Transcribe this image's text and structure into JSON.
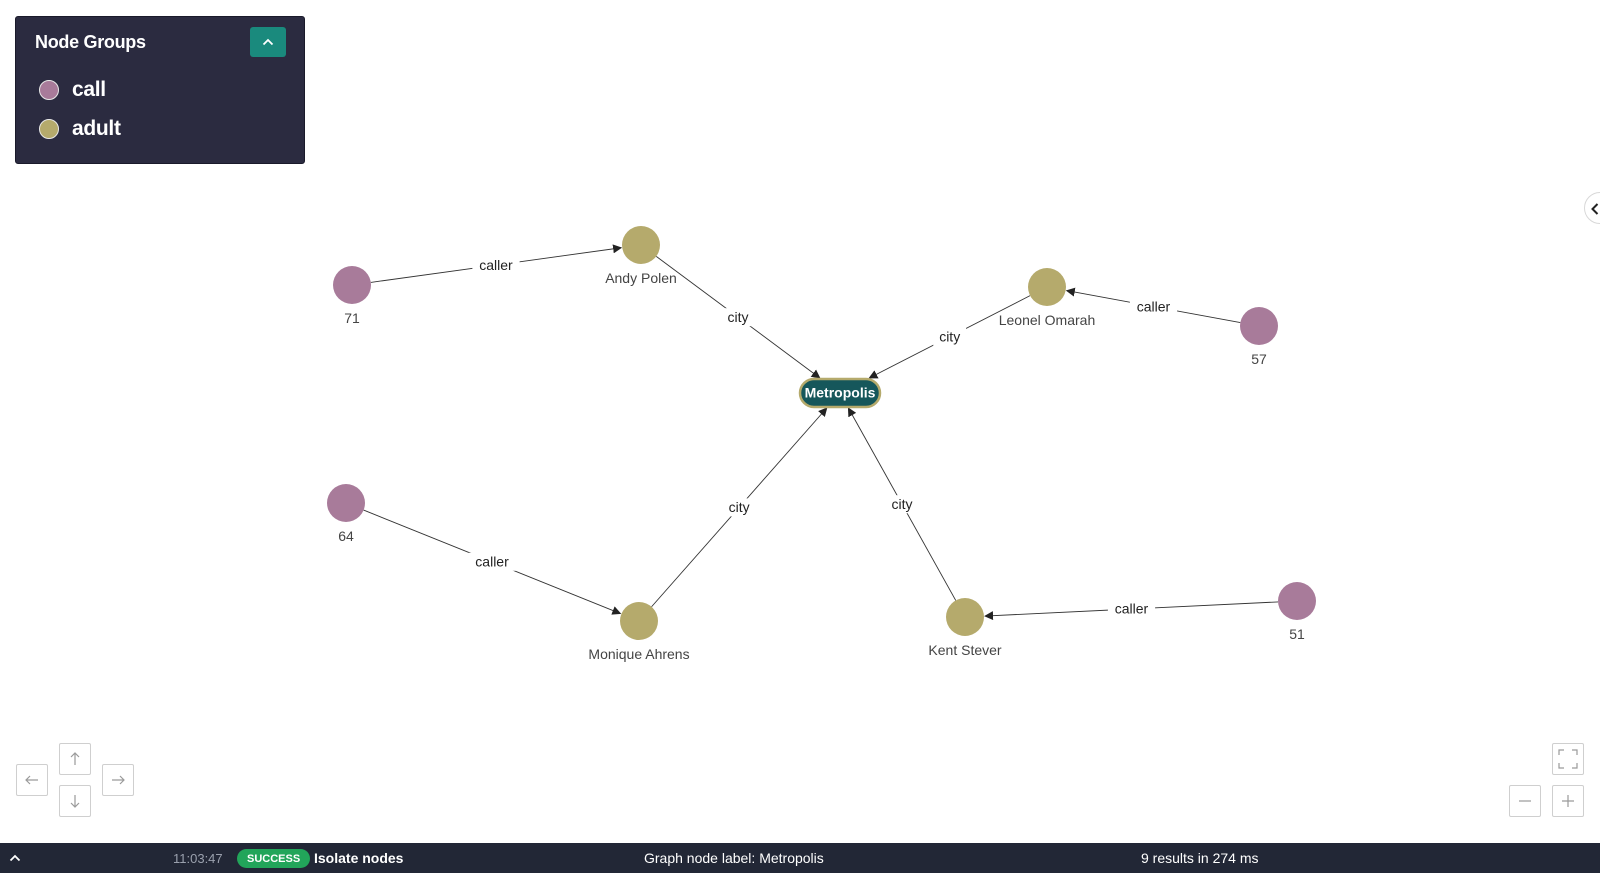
{
  "legend": {
    "title": "Node Groups",
    "groups": [
      {
        "label": "call",
        "color": "#a87b9a"
      },
      {
        "label": "adult",
        "color": "#b5aa6c"
      }
    ]
  },
  "graph": {
    "hub": {
      "label": "Metropolis",
      "fill": "#16575b",
      "border": "#b5aa6c"
    },
    "colors": {
      "call": "#a87b9a",
      "adult": "#b5aa6c",
      "edge": "#333333"
    },
    "nodes": [
      {
        "label": "71",
        "group": "call"
      },
      {
        "label": "Andy Polen",
        "group": "adult"
      },
      {
        "label": "Leonel Omarah",
        "group": "adult"
      },
      {
        "label": "57",
        "group": "call"
      },
      {
        "label": "64",
        "group": "call"
      },
      {
        "label": "Monique Ahrens",
        "group": "adult"
      },
      {
        "label": "Kent Stever",
        "group": "adult"
      },
      {
        "label": "51",
        "group": "call"
      }
    ],
    "edges": [
      {
        "from": "71",
        "to": "Andy Polen",
        "label": "caller"
      },
      {
        "from": "57",
        "to": "Leonel Omarah",
        "label": "caller"
      },
      {
        "from": "64",
        "to": "Monique Ahrens",
        "label": "caller"
      },
      {
        "from": "51",
        "to": "Kent Stever",
        "label": "caller"
      },
      {
        "from": "Andy Polen",
        "to": "Metropolis",
        "label": "city"
      },
      {
        "from": "Leonel Omarah",
        "to": "Metropolis",
        "label": "city"
      },
      {
        "from": "Monique Ahrens",
        "to": "Metropolis",
        "label": "city"
      },
      {
        "from": "Kent Stever",
        "to": "Metropolis",
        "label": "city"
      }
    ]
  },
  "navigation": {
    "left_icon": "arrow-left-icon",
    "up_icon": "arrow-up-icon",
    "down_icon": "arrow-down-icon",
    "right_icon": "arrow-right-icon",
    "fullscreen_icon": "fullscreen-icon",
    "zoom_out_icon": "minus-icon",
    "zoom_in_icon": "plus-icon"
  },
  "status_bar": {
    "time": "11:03:47",
    "badge": "SUCCESS",
    "badge_color": "#22a55a",
    "action": "Isolate nodes",
    "query_label": "Graph node label: Metropolis",
    "results": "9 results in 274 ms"
  }
}
